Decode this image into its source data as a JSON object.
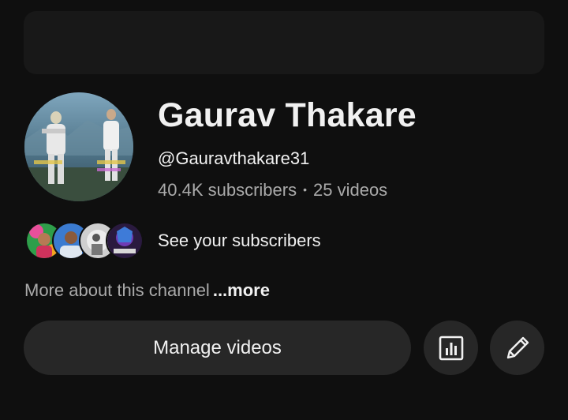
{
  "channel": {
    "name": "Gaurav Thakare",
    "handle": "@Gauravthakare31",
    "subscribers": "40.4K subscribers",
    "separator": "•",
    "videos": "25 videos"
  },
  "subscribers_preview": {
    "label": "See your subscribers",
    "avatars": [
      "subscriber-avatar-1",
      "subscriber-avatar-2",
      "subscriber-avatar-3",
      "subscriber-avatar-4"
    ]
  },
  "about": {
    "text": "More about this channel",
    "more_link": "...more"
  },
  "actions": {
    "manage_label": "Manage videos",
    "analytics_icon": "analytics-icon",
    "edit_icon": "pencil-icon"
  },
  "colors": {
    "background": "#0f0f0f",
    "button_bg": "#272727",
    "primary_text": "#f1f1f1",
    "secondary_text": "#aaaaaa"
  }
}
